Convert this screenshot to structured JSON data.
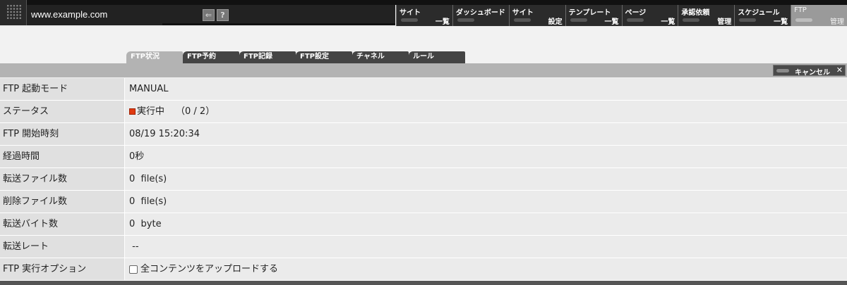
{
  "header": {
    "url": "www.example.com",
    "back_icon": "arrow-left-icon",
    "help_label": "?"
  },
  "nav": [
    {
      "top": "サイト",
      "bottom": "一覧",
      "active": false
    },
    {
      "top": "ダッシュボード",
      "bottom": "",
      "active": false
    },
    {
      "top": "サイト",
      "bottom": "設定",
      "active": false
    },
    {
      "top": "テンプレート",
      "bottom": "一覧",
      "active": false
    },
    {
      "top": "ページ",
      "bottom": "一覧",
      "active": false
    },
    {
      "top": "承認依頼",
      "bottom": "管理",
      "active": false
    },
    {
      "top": "スケジュール",
      "bottom": "一覧",
      "active": false
    },
    {
      "top": "FTP",
      "bottom": "管理",
      "active": true
    }
  ],
  "tabs": [
    {
      "label": "FTP状況",
      "active": true
    },
    {
      "label": "FTP予約",
      "active": false
    },
    {
      "label": "FTP記録",
      "active": false
    },
    {
      "label": "FTP設定",
      "active": false
    },
    {
      "label": "チャネル",
      "active": false
    },
    {
      "label": "ルール",
      "active": false
    }
  ],
  "cancel": {
    "label": "キャンセル",
    "close": "✕"
  },
  "rows": {
    "mode": {
      "label": "FTP 起動モード",
      "value": "MANUAL"
    },
    "status": {
      "label": "ステータス",
      "value": "実行中",
      "progress": "（0 / 2）"
    },
    "start": {
      "label": "FTP 開始時刻",
      "value": "08/19 15:20:34"
    },
    "elapsed": {
      "label": "経過時間",
      "value": "0秒"
    },
    "files_sent": {
      "label": "転送ファイル数",
      "value": "0  file(s)"
    },
    "files_deleted": {
      "label": "削除ファイル数",
      "value": "0  file(s)"
    },
    "bytes": {
      "label": "転送バイト数",
      "value": "0  byte"
    },
    "rate": {
      "label": "転送レート",
      "value": " --"
    },
    "option": {
      "label": "FTP 実行オプション",
      "checkbox_label": "全コンテンツをアップロードする"
    }
  },
  "colors": {
    "status_running": "#e03a10",
    "nav_bg": "#2b2b2b",
    "nav_active": "#9a9a9a"
  }
}
